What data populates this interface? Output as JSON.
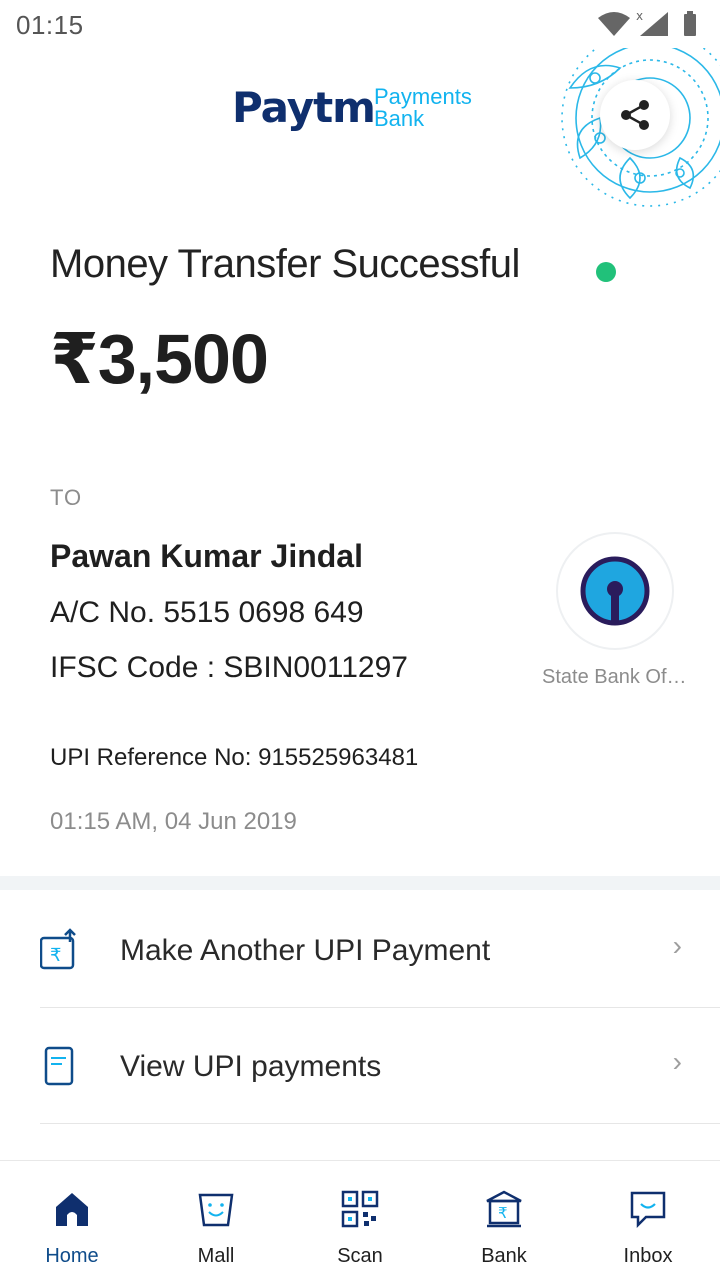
{
  "status_bar": {
    "time": "01:15"
  },
  "header": {
    "logo_main": "Paytm",
    "logo_sub_1": "Payments",
    "logo_sub_2": "Bank"
  },
  "transaction": {
    "title": "Money Transfer Successful",
    "status_color": "#21c17a",
    "amount": "₹3,500",
    "to_label": "TO",
    "payee_name": "Pawan Kumar Jindal",
    "account": "A/C No. 5515 0698 649",
    "ifsc": "IFSC Code : SBIN0011297",
    "bank_name": "State Bank Of India",
    "upi_reference": "UPI Reference No: 915525963481",
    "timestamp": "01:15 AM, 04 Jun 2019"
  },
  "actions": [
    {
      "label": "Make Another UPI Payment",
      "icon": "upi-send-icon"
    },
    {
      "label": "View UPI payments",
      "icon": "passbook-icon"
    }
  ],
  "nav": [
    {
      "label": "Home",
      "icon": "home-icon",
      "active": true
    },
    {
      "label": "Mall",
      "icon": "mall-bag-icon"
    },
    {
      "label": "Scan",
      "icon": "qr-scan-icon"
    },
    {
      "label": "Bank",
      "icon": "bank-icon"
    },
    {
      "label": "Inbox",
      "icon": "chat-icon"
    }
  ],
  "colors": {
    "brand_dark": "#0f2f6e",
    "brand_light": "#12b3ef",
    "nav_active": "#0f4c8a"
  }
}
